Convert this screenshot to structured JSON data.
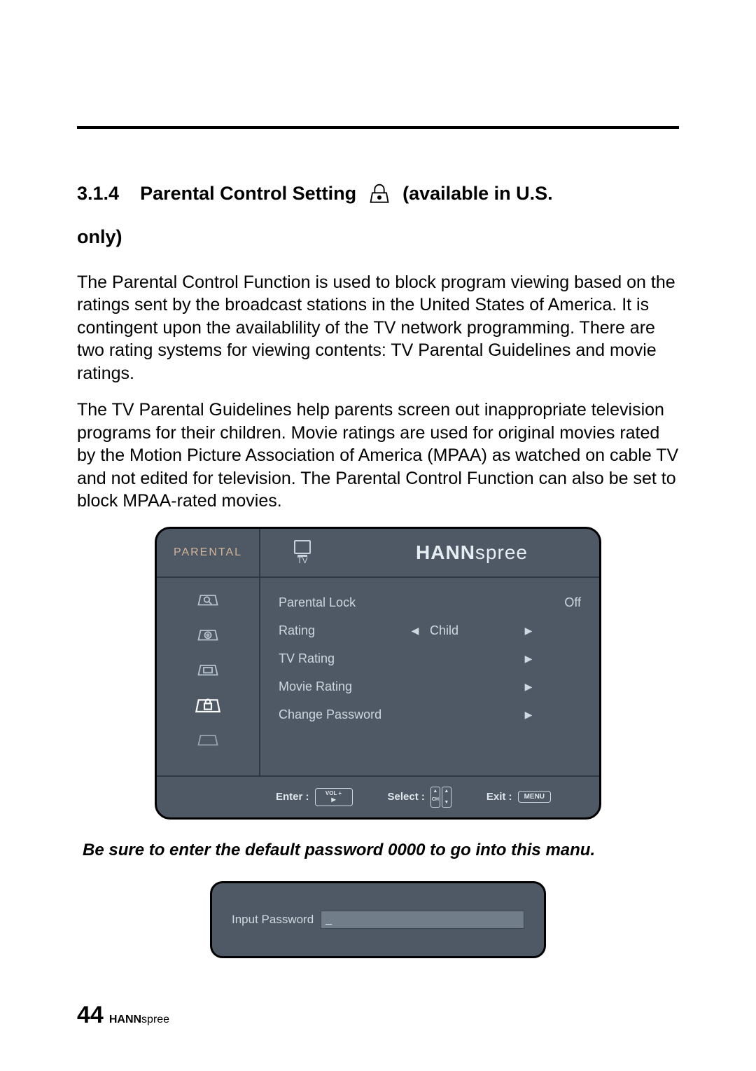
{
  "section": {
    "number": "3.1.4",
    "title_part1": "Parental Control Setting",
    "title_part2": "(available in U.S.",
    "title_line2": "only)"
  },
  "paragraphs": {
    "p1": "The Parental Control Function is used to block program viewing based on the ratings sent by the broadcast stations in the United States of America. It is contingent upon the availablility of the TV network programming. There are two rating systems for viewing contents: TV Parental Guidelines and movie ratings.",
    "p2": "The TV Parental Guidelines help parents screen out inappropriate television programs for their children. Movie ratings are used for original movies rated by the Motion Picture Association of America (MPAA) as watched on cable TV and not edited for television. The Parental Control Function can also be set to block MPAA-rated movies."
  },
  "osd": {
    "title_left": "PARENTAL",
    "tab_label": "TV",
    "brand_bold": "HANN",
    "brand_light": "spree",
    "rows": [
      {
        "label": "Parental Lock",
        "left_arrow": "",
        "value": "",
        "right_arrow": "",
        "trail": "Off"
      },
      {
        "label": "Rating",
        "left_arrow": "◀",
        "value": "Child",
        "right_arrow": "▶",
        "trail": ""
      },
      {
        "label": "TV Rating",
        "left_arrow": "",
        "value": "",
        "right_arrow": "▶",
        "trail": ""
      },
      {
        "label": "Movie Rating",
        "left_arrow": "",
        "value": "",
        "right_arrow": "▶",
        "trail": ""
      },
      {
        "label": "Change Password",
        "left_arrow": "",
        "value": "",
        "right_arrow": "▶",
        "trail": ""
      }
    ],
    "footer": {
      "enter": "Enter :",
      "vol_label": "VOL +",
      "select": "Select :",
      "ch_label": "CH",
      "exit": "Exit :",
      "menu_label": "MENU"
    }
  },
  "note": "Be sure to enter the default password 0000 to go into this manu.",
  "password_panel": {
    "label": "Input Password",
    "value": "_"
  },
  "footer": {
    "page": "44",
    "brand_bold": "HANN",
    "brand_light": "spree"
  }
}
